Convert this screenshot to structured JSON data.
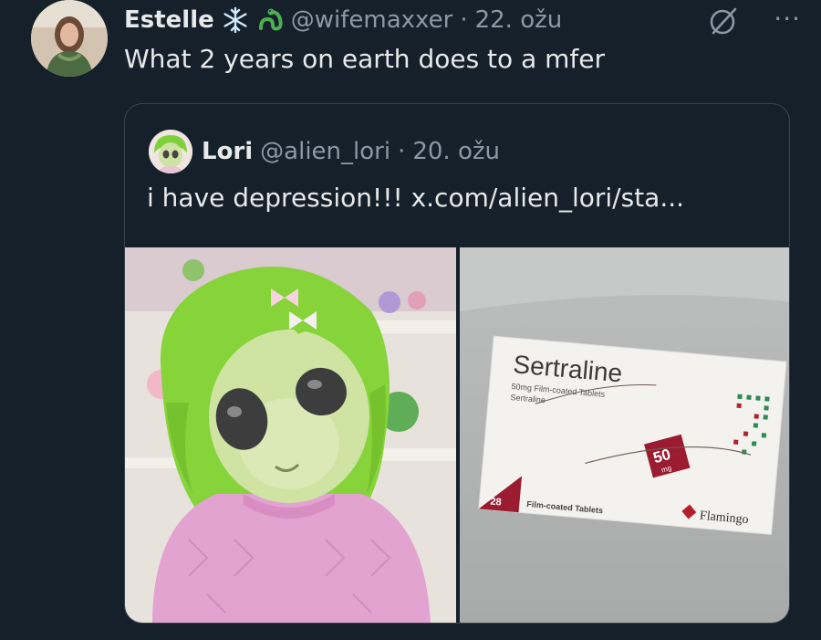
{
  "tweet": {
    "name": "Estelle",
    "handle": "@wifemaxxer",
    "dot": "·",
    "date": "22. ožu",
    "text": "What 2 years on earth does to a mfer",
    "more_label": "···"
  },
  "quoted": {
    "name": "Lori",
    "handle": "@alien_lori",
    "dot": "·",
    "date": "20. ožu",
    "text": "i have depression!!!  x.com/alien_lori/sta...",
    "box": {
      "brand": "Sertraline",
      "sub1": "50mg Film-coated Tablets",
      "sub2": "Sertraline",
      "dose": "50",
      "dose_unit": "mg",
      "count": "28",
      "count_label": "Film-coated Tablets",
      "maker": "Flamingo"
    }
  },
  "colors": {
    "background": "#15202b",
    "text": "#e7e9ea",
    "muted": "#8b98a5",
    "border": "#38444d"
  },
  "icons": [
    "snowflake-icon",
    "sea-serpent-icon",
    "grok-icon",
    "more-icon"
  ]
}
